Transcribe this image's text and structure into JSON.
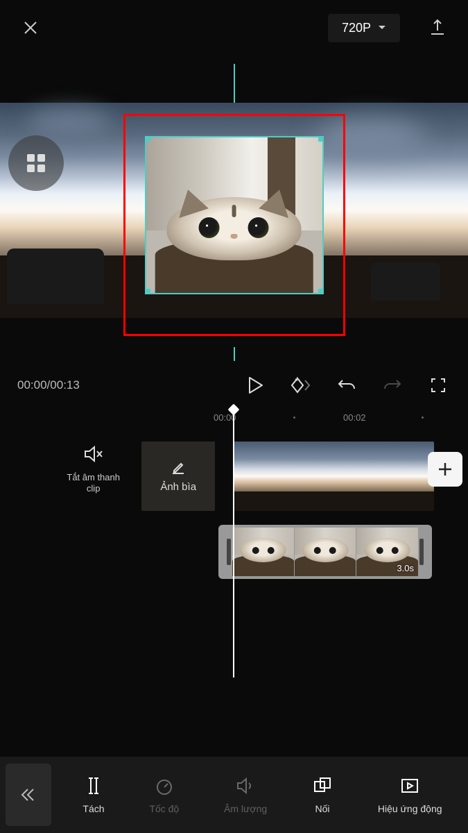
{
  "header": {
    "resolution": "720P"
  },
  "playback": {
    "current_time": "00:00",
    "total_time": "00:13"
  },
  "ruler": {
    "marks": [
      "00:00",
      "00:02"
    ]
  },
  "timeline": {
    "mute_label": "Tắt âm thanh clip",
    "cover_label": "Ảnh bìa",
    "overlay_duration": "3.0s"
  },
  "toolbar": {
    "items": [
      {
        "id": "split",
        "label": "Tách",
        "enabled": true
      },
      {
        "id": "speed",
        "label": "Tốc độ",
        "enabled": false
      },
      {
        "id": "volume",
        "label": "Âm lượng",
        "enabled": false
      },
      {
        "id": "splice",
        "label": "Nối",
        "enabled": true
      },
      {
        "id": "animation",
        "label": "Hiệu ứng động",
        "enabled": true
      }
    ]
  }
}
